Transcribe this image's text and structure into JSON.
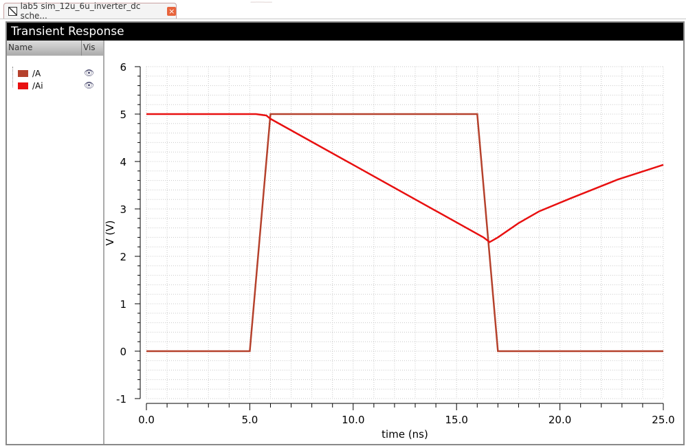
{
  "tab": {
    "label": "lab5 sim_12u_6u_inverter_dc sche...",
    "close": "×"
  },
  "title": "Transient Response",
  "legend": {
    "col_name": "Name",
    "col_vis": "Vis",
    "items": [
      {
        "name": "/A",
        "color": "#b5412c"
      },
      {
        "name": "/Ai",
        "color": "#e81010"
      }
    ]
  },
  "chart_data": {
    "type": "line",
    "xlabel": "time (ns)",
    "ylabel": "V (V)",
    "xlim": [
      0,
      25
    ],
    "ylim": [
      -1,
      6
    ],
    "xticks": [
      "0.0",
      "5.0",
      "10.0",
      "15.0",
      "20.0",
      "25.0"
    ],
    "yticks": [
      "6",
      "5",
      "4",
      "3",
      "2",
      "1",
      "0",
      "-1"
    ],
    "grid": true,
    "series": [
      {
        "name": "/A",
        "color": "#b5412c",
        "x": [
          0,
          5,
          6,
          16,
          17,
          25
        ],
        "y": [
          0,
          0,
          5,
          5,
          0,
          0
        ]
      },
      {
        "name": "/Ai",
        "color": "#e81010",
        "x": [
          0,
          5.3,
          5.8,
          6,
          10,
          16.3,
          16.6,
          17,
          18,
          19,
          20.5,
          22.8,
          25
        ],
        "y": [
          5,
          5,
          4.97,
          4.9,
          3.93,
          2.4,
          2.3,
          2.4,
          2.7,
          2.95,
          3.22,
          3.62,
          3.93
        ]
      }
    ]
  }
}
